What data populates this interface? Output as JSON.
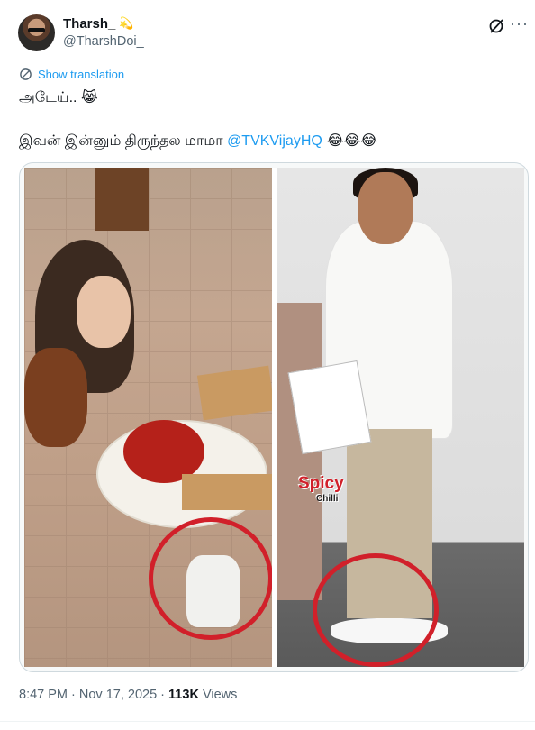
{
  "author": {
    "display_name": "Tharsh_",
    "badge_icon": "dizzy-star-emoji",
    "handle": "@TharshDoi_"
  },
  "actions": {
    "grok_icon": "grok-icon",
    "more_label": "···"
  },
  "translation": {
    "label": "Show translation",
    "icon": "translate-icon"
  },
  "tweet": {
    "line1_text": "அடேய்..",
    "line1_emoji": "😹",
    "line2_text": "இவன் இன்னும் திருந்தல மாமா ",
    "line2_mention": "@TVKVijayHQ",
    "line2_emoji": " 😂😂😂"
  },
  "media": {
    "watermark_main": "Spicy",
    "watermark_sub": "Chilli"
  },
  "meta": {
    "time": "8:47 PM",
    "separator": " · ",
    "date": "Nov 17, 2025",
    "views_count": "113K",
    "views_label": " Views"
  },
  "colors": {
    "accent": "#1d9bf0",
    "text": "#0f1419",
    "secondary": "#536471",
    "annotation_red": "#d1202a"
  }
}
